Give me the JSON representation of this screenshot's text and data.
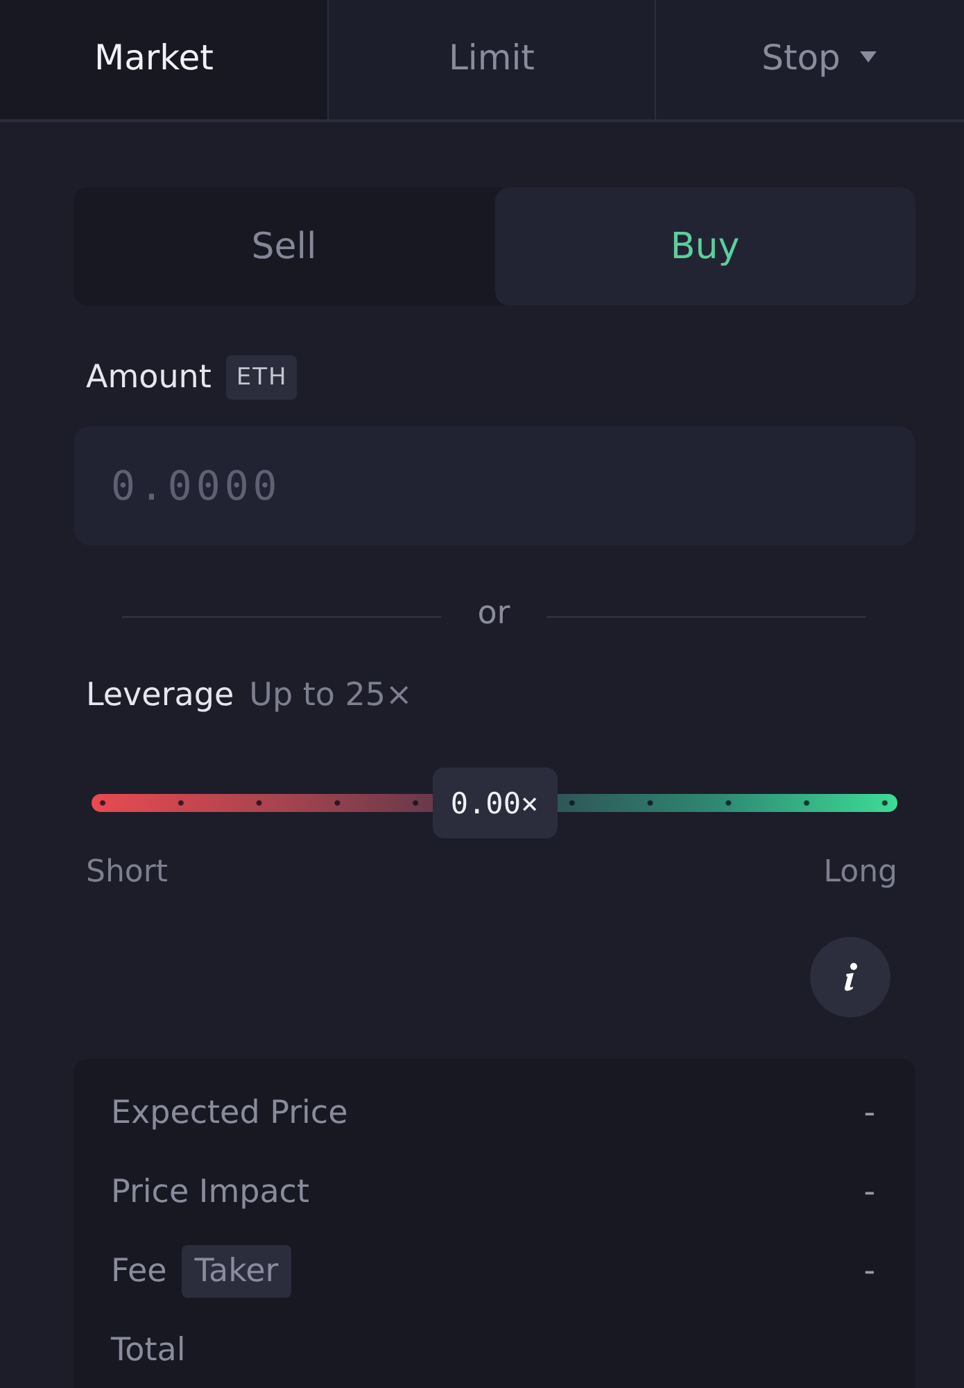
{
  "order_tabs": [
    {
      "label": "Market",
      "selected": true,
      "dropdown": false
    },
    {
      "label": "Limit",
      "selected": false,
      "dropdown": false
    },
    {
      "label": "Stop",
      "selected": false,
      "dropdown": true
    }
  ],
  "side_toggle": [
    {
      "label": "Sell",
      "selected": false
    },
    {
      "label": "Buy",
      "selected": true
    }
  ],
  "amount": {
    "label": "Amount",
    "unit": "ETH",
    "placeholder": "0.0000"
  },
  "divider": {
    "label": "or"
  },
  "leverage": {
    "label": "Leverage",
    "hint": "Up to 25×",
    "reading": "0.00×",
    "level": 0.5,
    "min_label": "Short",
    "max_label": "Long"
  },
  "summary": [
    {
      "label": "Expected Price",
      "value": "-"
    },
    {
      "label": "Price Impact",
      "value": "-"
    },
    {
      "label": "Fee",
      "tag": "Taker",
      "value": "-"
    },
    {
      "label": "Total"
    }
  ]
}
